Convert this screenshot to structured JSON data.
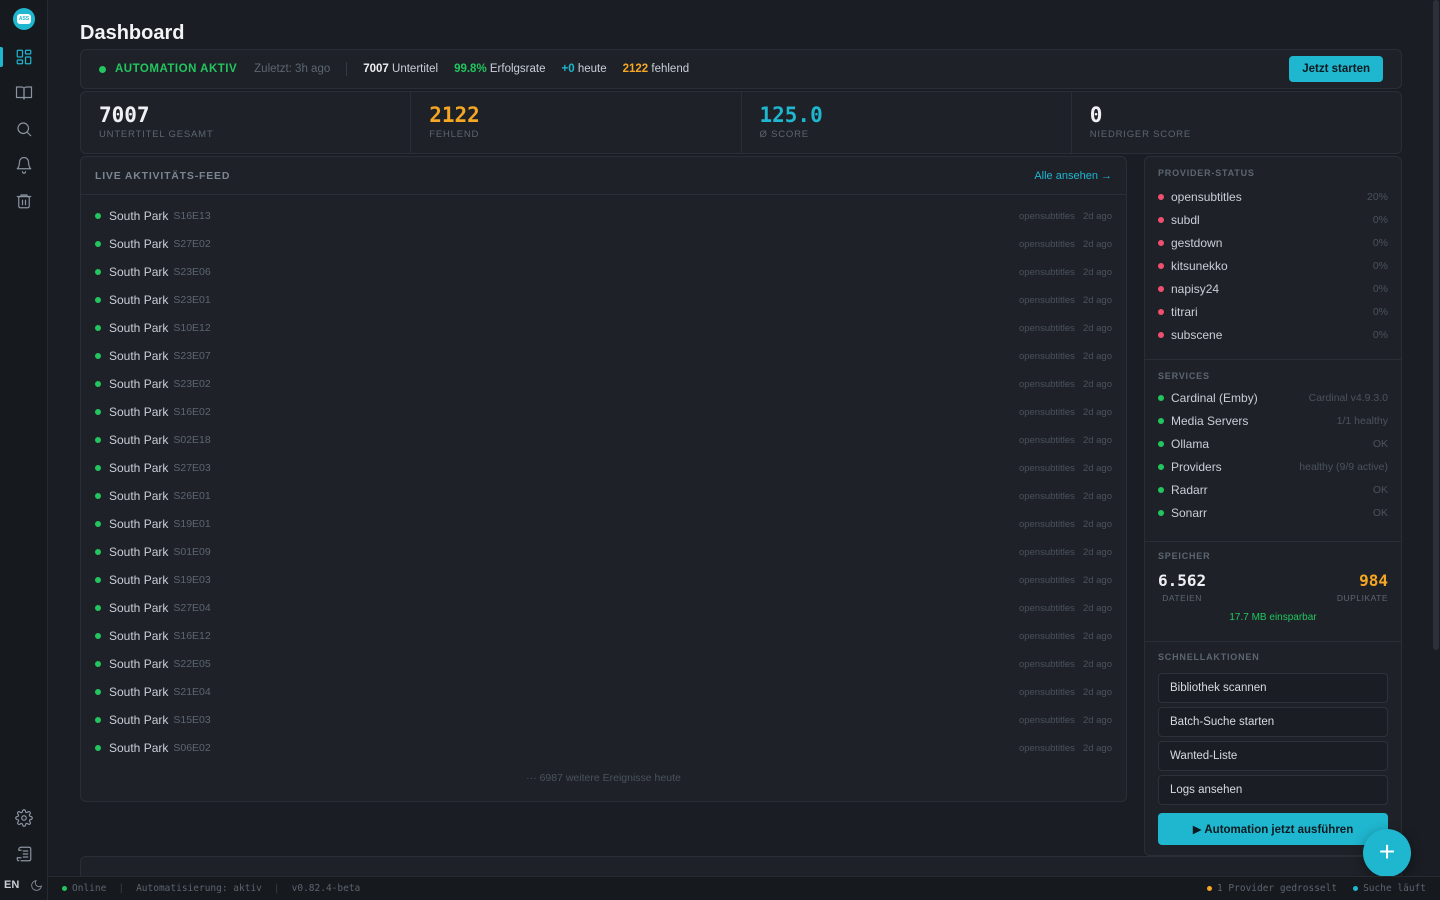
{
  "app": {
    "title": "Dashboard",
    "lang": "EN"
  },
  "colors": {
    "accent": "#1fb6cf",
    "success": "#22c55e",
    "warning": "#f59e0b",
    "danger": "#f0506e"
  },
  "sidebar": {
    "items": [
      {
        "icon": "dashboard-icon",
        "active": true
      },
      {
        "icon": "library-book-icon",
        "active": false
      },
      {
        "icon": "search-icon",
        "active": false
      },
      {
        "icon": "bell-icon",
        "active": false
      },
      {
        "icon": "trash-icon",
        "active": false
      }
    ],
    "bottom": [
      {
        "icon": "gear-icon"
      },
      {
        "icon": "logs-icon"
      }
    ]
  },
  "automation": {
    "status": "AUTOMATION AKTIV",
    "last_run": "Zuletzt: 3h ago",
    "subtitles_count": "7007",
    "subtitles_label": "Untertitel",
    "success_rate": "99.8%",
    "success_label": "Erfolgsrate",
    "today_count": "+0",
    "today_label": "heute",
    "missing_count": "2122",
    "missing_label": "fehlend",
    "start_button": "Jetzt starten"
  },
  "kpis": [
    {
      "value": "7007",
      "label": "UNTERTITEL GESAMT",
      "color": "#eef0f3"
    },
    {
      "value": "2122",
      "label": "FEHLEND",
      "color": "#f5a623"
    },
    {
      "value": "125.0",
      "label": "Ø SCORE",
      "color": "#1fb6cf"
    },
    {
      "value": "0",
      "label": "NIEDRIGER SCORE",
      "color": "#eef0f3"
    }
  ],
  "feed": {
    "title": "LIVE AKTIVITÄTS-FEED",
    "view_all": "Alle ansehen →",
    "more": "··· 6987 weitere Ereignisse heute",
    "items": [
      {
        "show": "South Park",
        "episode": "S16E13",
        "provider": "opensubtitles",
        "time": "2d ago"
      },
      {
        "show": "South Park",
        "episode": "S27E02",
        "provider": "opensubtitles",
        "time": "2d ago"
      },
      {
        "show": "South Park",
        "episode": "S23E06",
        "provider": "opensubtitles",
        "time": "2d ago"
      },
      {
        "show": "South Park",
        "episode": "S23E01",
        "provider": "opensubtitles",
        "time": "2d ago"
      },
      {
        "show": "South Park",
        "episode": "S10E12",
        "provider": "opensubtitles",
        "time": "2d ago"
      },
      {
        "show": "South Park",
        "episode": "S23E07",
        "provider": "opensubtitles",
        "time": "2d ago"
      },
      {
        "show": "South Park",
        "episode": "S23E02",
        "provider": "opensubtitles",
        "time": "2d ago"
      },
      {
        "show": "South Park",
        "episode": "S16E02",
        "provider": "opensubtitles",
        "time": "2d ago"
      },
      {
        "show": "South Park",
        "episode": "S02E18",
        "provider": "opensubtitles",
        "time": "2d ago"
      },
      {
        "show": "South Park",
        "episode": "S27E03",
        "provider": "opensubtitles",
        "time": "2d ago"
      },
      {
        "show": "South Park",
        "episode": "S26E01",
        "provider": "opensubtitles",
        "time": "2d ago"
      },
      {
        "show": "South Park",
        "episode": "S19E01",
        "provider": "opensubtitles",
        "time": "2d ago"
      },
      {
        "show": "South Park",
        "episode": "S01E09",
        "provider": "opensubtitles",
        "time": "2d ago"
      },
      {
        "show": "South Park",
        "episode": "S19E03",
        "provider": "opensubtitles",
        "time": "2d ago"
      },
      {
        "show": "South Park",
        "episode": "S27E04",
        "provider": "opensubtitles",
        "time": "2d ago"
      },
      {
        "show": "South Park",
        "episode": "S16E12",
        "provider": "opensubtitles",
        "time": "2d ago"
      },
      {
        "show": "South Park",
        "episode": "S22E05",
        "provider": "opensubtitles",
        "time": "2d ago"
      },
      {
        "show": "South Park",
        "episode": "S21E04",
        "provider": "opensubtitles",
        "time": "2d ago"
      },
      {
        "show": "South Park",
        "episode": "S15E03",
        "provider": "opensubtitles",
        "time": "2d ago"
      },
      {
        "show": "South Park",
        "episode": "S06E02",
        "provider": "opensubtitles",
        "time": "2d ago"
      }
    ]
  },
  "providers": {
    "title": "PROVIDER-STATUS",
    "items": [
      {
        "name": "opensubtitles",
        "value": "20%",
        "status": "down"
      },
      {
        "name": "subdl",
        "value": "0%",
        "status": "down"
      },
      {
        "name": "gestdown",
        "value": "0%",
        "status": "down"
      },
      {
        "name": "kitsunekko",
        "value": "0%",
        "status": "down"
      },
      {
        "name": "napisy24",
        "value": "0%",
        "status": "down"
      },
      {
        "name": "titrari",
        "value": "0%",
        "status": "down"
      },
      {
        "name": "subscene",
        "value": "0%",
        "status": "down"
      }
    ]
  },
  "services": {
    "title": "SERVICES",
    "items": [
      {
        "name": "Cardinal (Emby)",
        "value": "Cardinal v4.9.3.0"
      },
      {
        "name": "Media Servers",
        "value": "1/1 healthy"
      },
      {
        "name": "Ollama",
        "value": "OK"
      },
      {
        "name": "Providers",
        "value": "healthy (9/9 active)"
      },
      {
        "name": "Radarr",
        "value": "OK"
      },
      {
        "name": "Sonarr",
        "value": "OK"
      }
    ]
  },
  "storage": {
    "title": "SPEICHER",
    "files_value": "6.562",
    "files_label": "DATEIEN",
    "dupes_value": "984",
    "dupes_label": "DUPLIKATE",
    "savings": "17.7 MB einsparbar"
  },
  "quick_actions": {
    "title": "SCHNELLAKTIONEN",
    "items": [
      "Bibliothek scannen",
      "Batch-Suche starten",
      "Wanted-Liste",
      "Logs ansehen"
    ],
    "run_button": "▶ Automation jetzt ausführen"
  },
  "statusbar": {
    "online": "Online",
    "automation": "Automatisierung: aktiv",
    "version": "v0.82.4-beta",
    "throttled": "1 Provider gedrosselt",
    "searching": "Suche läuft"
  }
}
